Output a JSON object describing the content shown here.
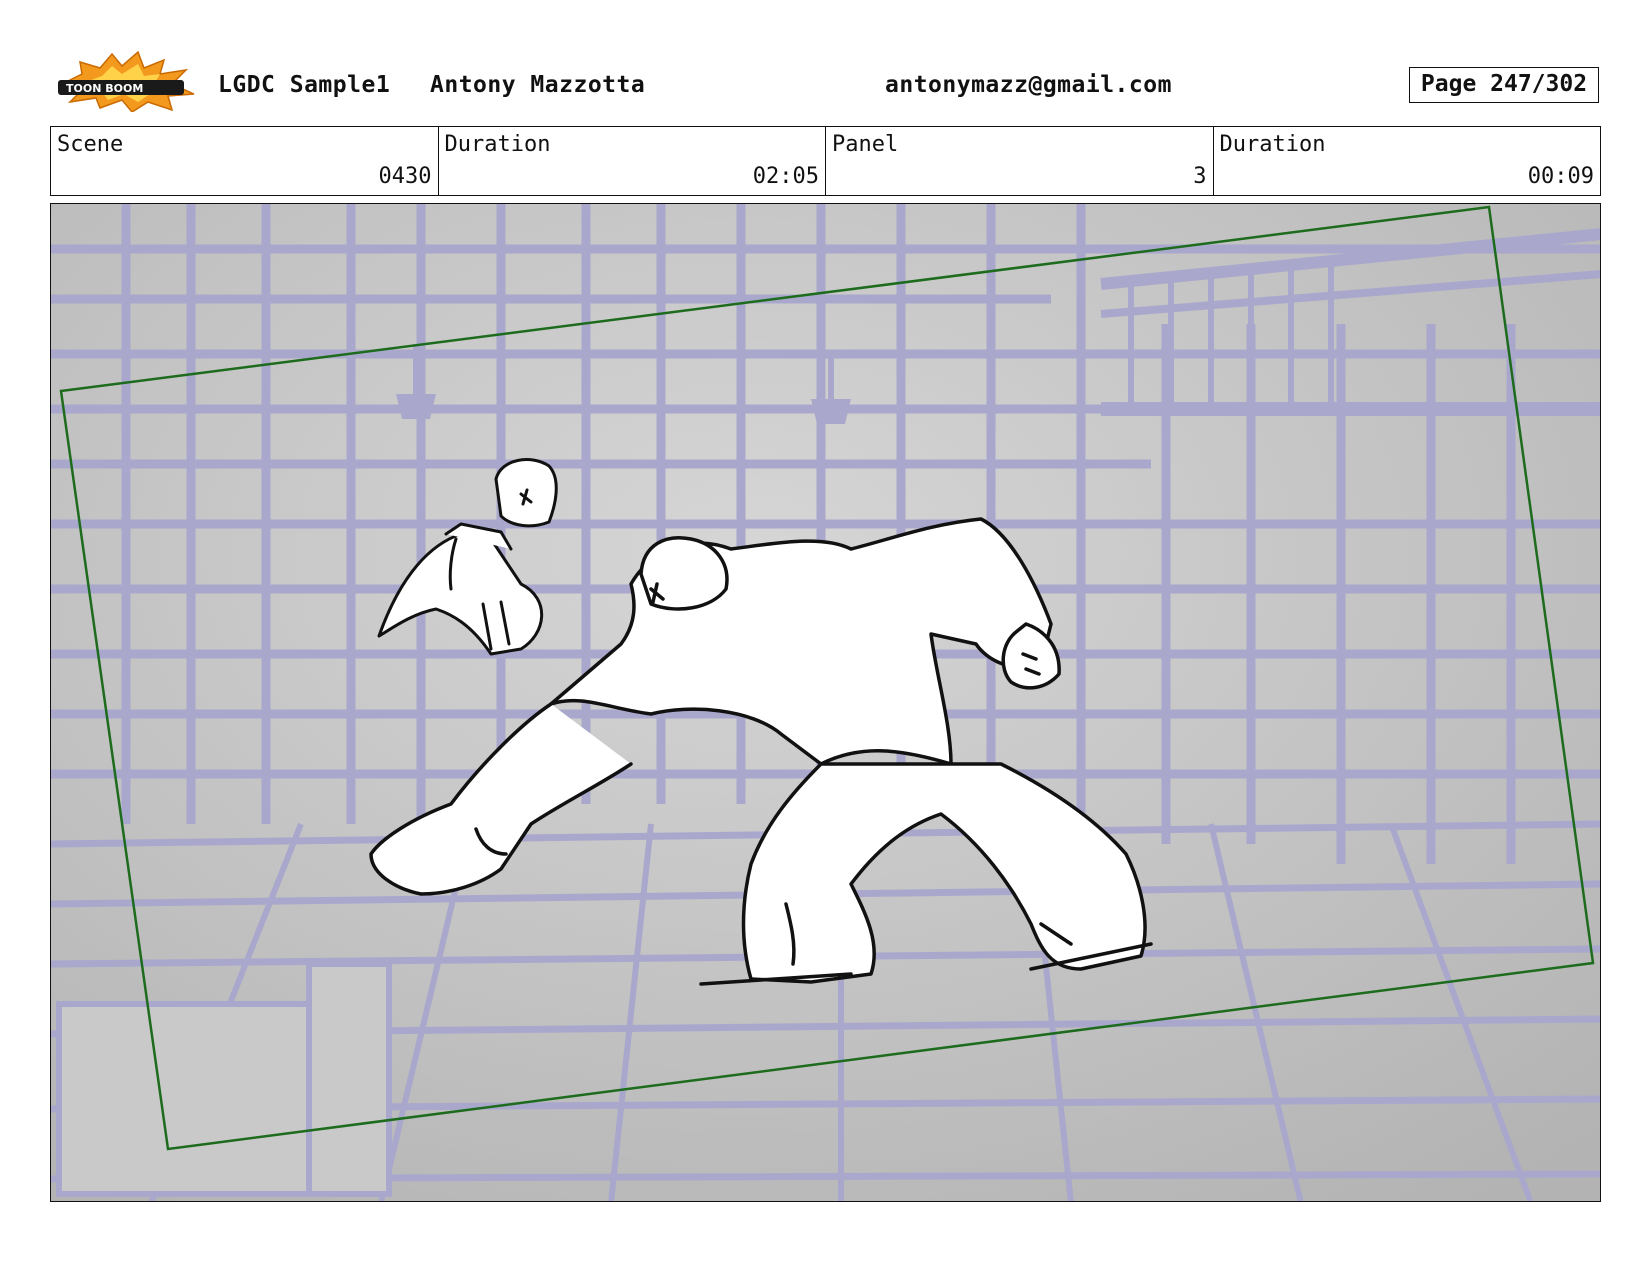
{
  "header": {
    "logo_alt": "TOON BOOM",
    "project": "LGDC Sample1",
    "author": "Antony Mazzotta",
    "email": "antonymazz@gmail.com",
    "page": "Page 247/302"
  },
  "info": {
    "scene_label": "Scene",
    "scene_value": "0430",
    "scene_duration_label": "Duration",
    "scene_duration_value": "02:05",
    "panel_label": "Panel",
    "panel_value": "3",
    "panel_duration_label": "Duration",
    "panel_duration_value": "00:09"
  },
  "colors": {
    "background_gray": "#bdbdbd",
    "background_lines": "#a9a8cc",
    "camera_frame": "#1d6b1d",
    "sketch_ink": "#111111"
  }
}
